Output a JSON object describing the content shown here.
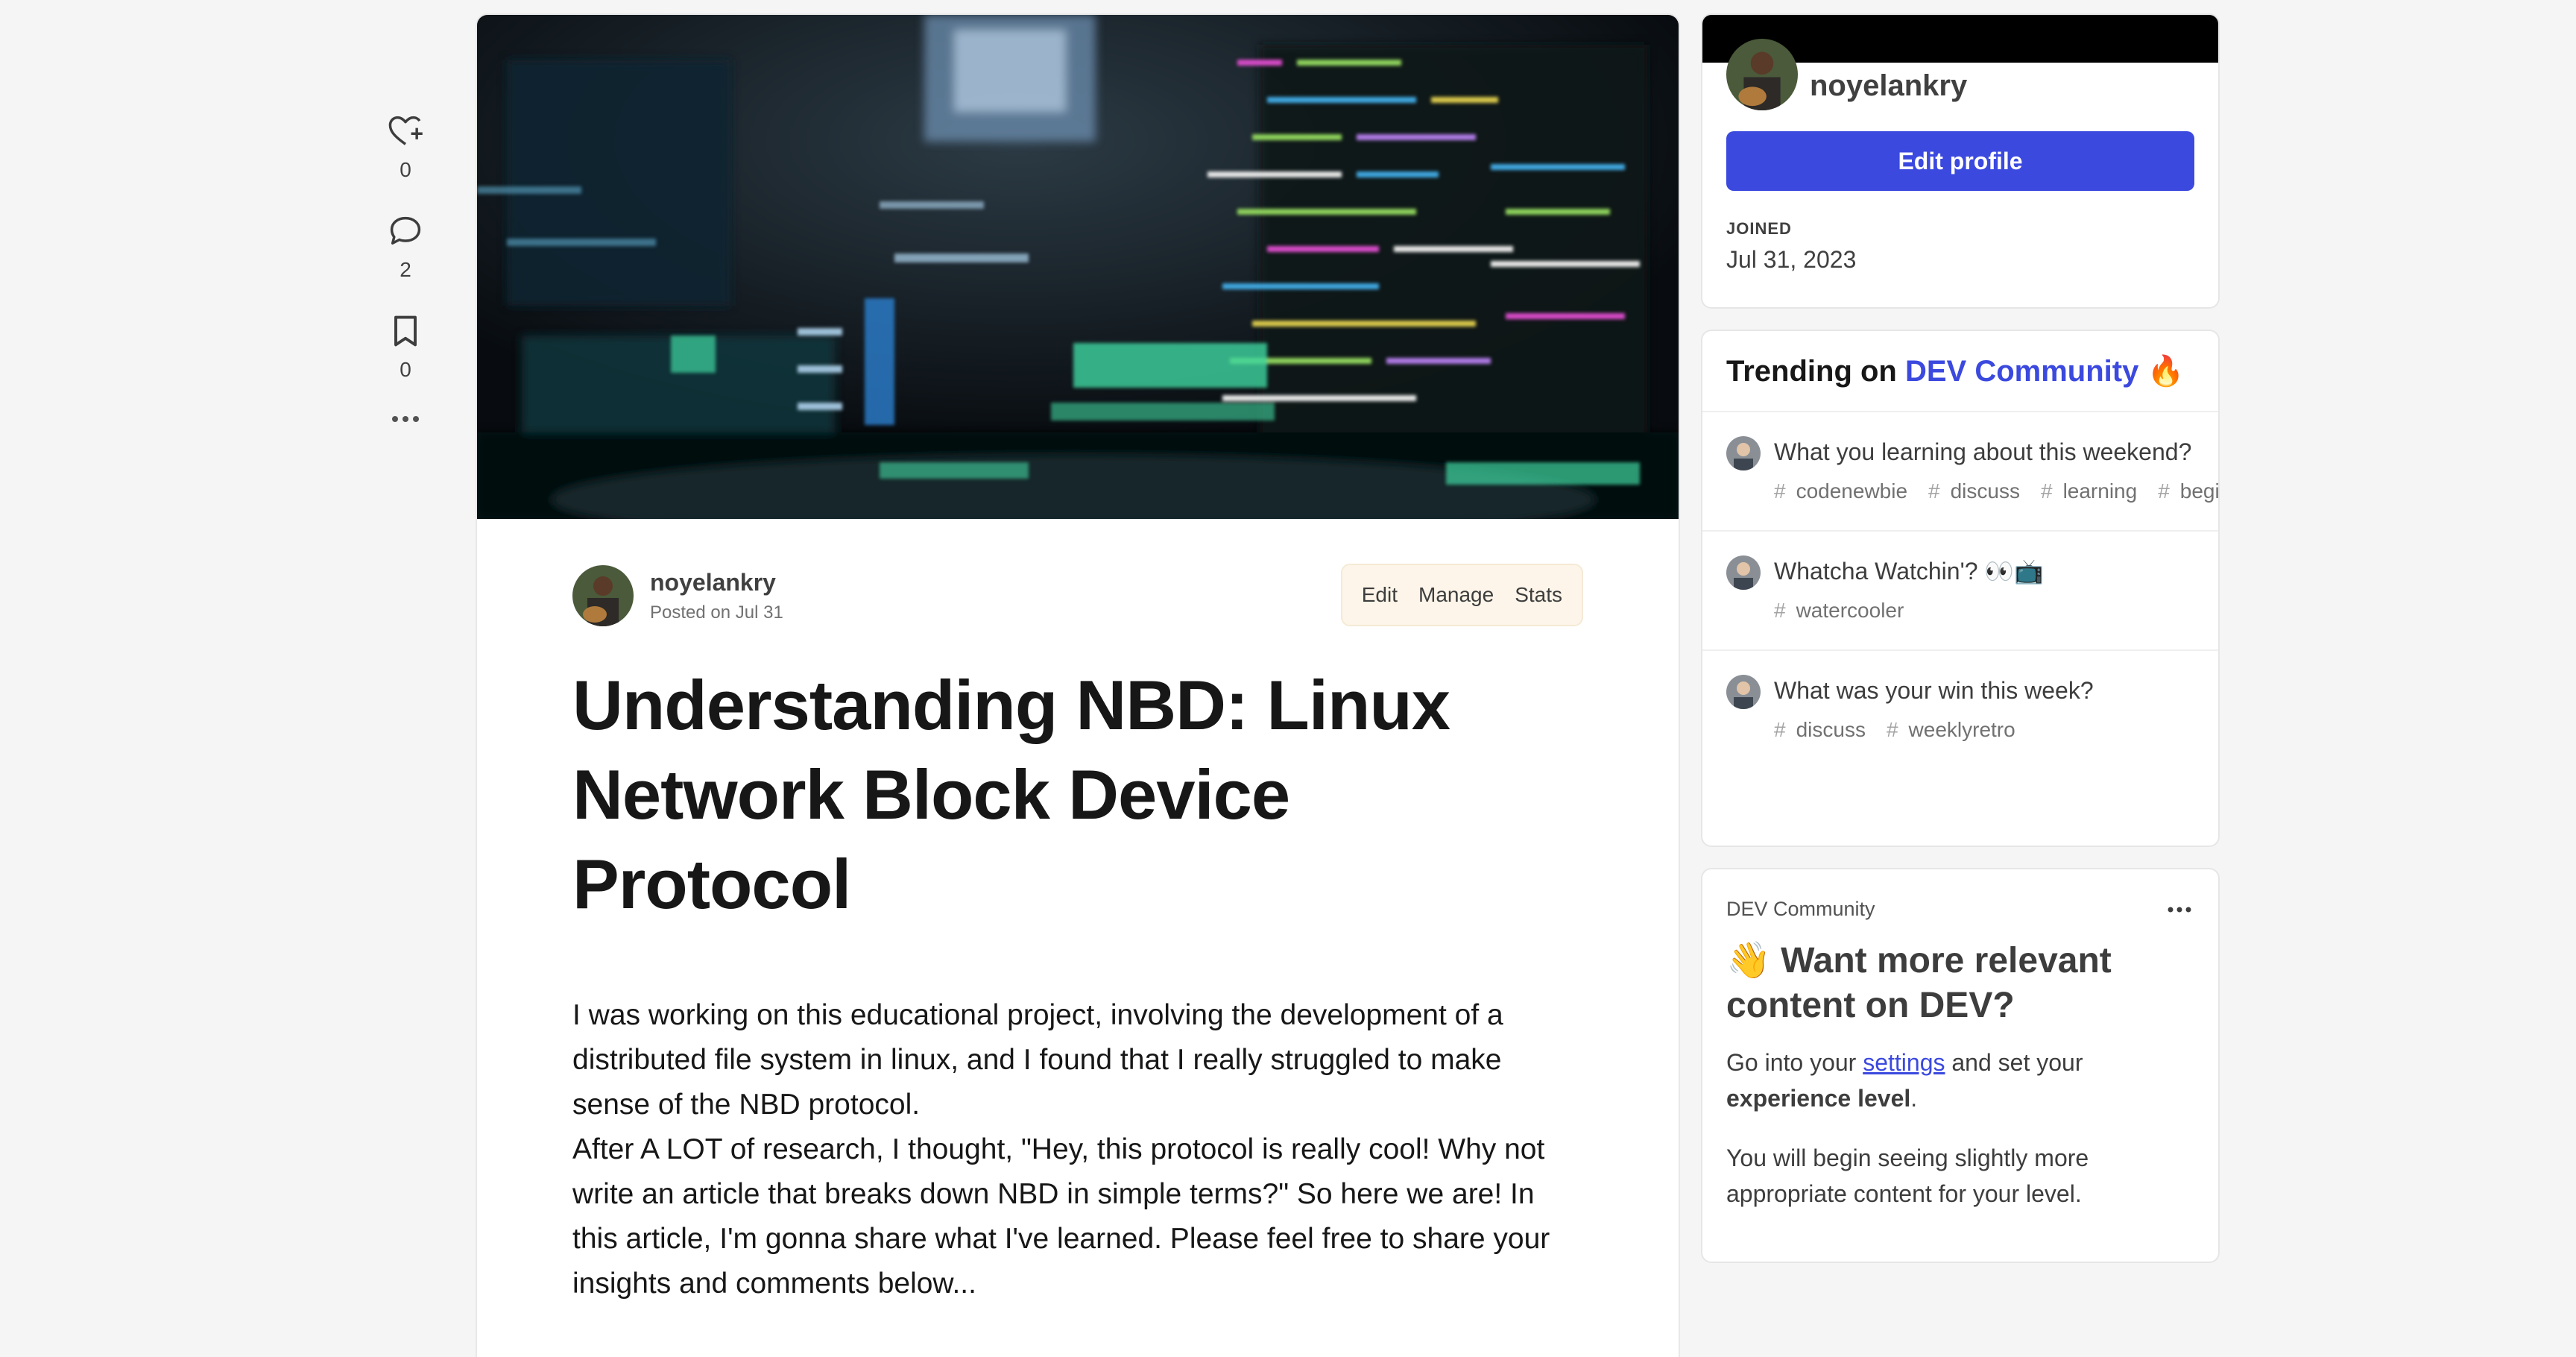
{
  "rail": {
    "reactions_count": "0",
    "comments_count": "2",
    "bookmarks_count": "0"
  },
  "article": {
    "author": "noyelankry",
    "posted": "Posted on Jul 31",
    "actions": {
      "edit": "Edit",
      "manage": "Manage",
      "stats": "Stats"
    },
    "title": "Understanding NBD: Linux Network Block Device Protocol",
    "paragraph1": "I was working on this educational project, involving the development of a distributed file system in linux, and I found that I really struggled to make sense of the NBD protocol.",
    "paragraph2": "After A LOT of research, I thought, \"Hey, this protocol is really cool! Why not write an article that breaks down NBD in simple terms?\" So here we are! In this article, I'm gonna share what I've learned. Please feel free to share your insights and comments below..."
  },
  "profile": {
    "name": "noyelankry",
    "edit_button": "Edit profile",
    "joined_label": "JOINED",
    "joined_date": "Jul 31, 2023"
  },
  "trending": {
    "prefix": "Trending on ",
    "brand": "DEV Community",
    "emoji": "🔥",
    "items": [
      {
        "title": "What you learning about this weekend?",
        "tags": [
          "codenewbie",
          "discuss",
          "learning",
          "beginners"
        ]
      },
      {
        "title": "Whatcha Watchin'? 👀📺",
        "tags": [
          "watercooler"
        ]
      },
      {
        "title": "What was your win this week?",
        "tags": [
          "discuss",
          "weeklyretro"
        ]
      }
    ]
  },
  "promo": {
    "source": "DEV Community",
    "title": "👋 Want more relevant content on DEV?",
    "text_before_link": "Go into your ",
    "link": "settings",
    "text_after_link": " and set your ",
    "bold": "experience level",
    "text_end": ".",
    "text2": "You will begin seeing slightly more appropriate content for your level."
  },
  "colors": {
    "accent": "#3b49df",
    "page_bg": "#f5f5f5",
    "actions_bg": "#fdf5e9"
  }
}
